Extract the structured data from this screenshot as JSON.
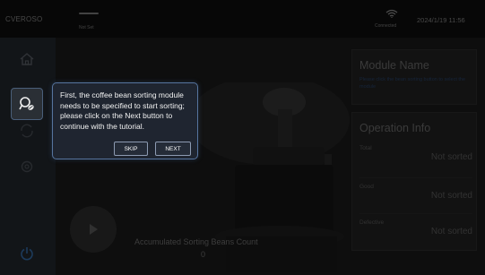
{
  "topbar": {
    "brand": "CVEROSO",
    "status_label": "Not Set",
    "wifi_label": "Connected",
    "datetime": "2024/1/19 11:56"
  },
  "sidebar": {
    "items": [
      {
        "icon": "home-icon"
      },
      {
        "icon": "bean-sort-icon",
        "active": true
      },
      {
        "icon": "sync-icon"
      },
      {
        "icon": "settings-icon"
      },
      {
        "icon": "power-icon"
      }
    ]
  },
  "main": {
    "count_label": "Accumulated Sorting Beans Count",
    "count_value": "0"
  },
  "module": {
    "title": "Module Name",
    "description": "Please click the bean sorting button to select the module"
  },
  "operation": {
    "title": "Operation Info",
    "rows": [
      {
        "label": "Total",
        "value": "Not sorted"
      },
      {
        "label": "Good",
        "value": "Not sorted"
      },
      {
        "label": "Defective",
        "value": "Not sorted"
      }
    ]
  },
  "tutorial": {
    "text": "First, the coffee bean sorting module needs to be specified to start sorting; please click on the Next button to continue with the tutorial.",
    "skip_label": "SKIP",
    "next_label": "NEXT"
  },
  "colors": {
    "accent": "#56749e",
    "panel_bg": "#1c1c1c",
    "sidebar_bg": "#1d2125",
    "power_icon": "#2c5a8c"
  }
}
